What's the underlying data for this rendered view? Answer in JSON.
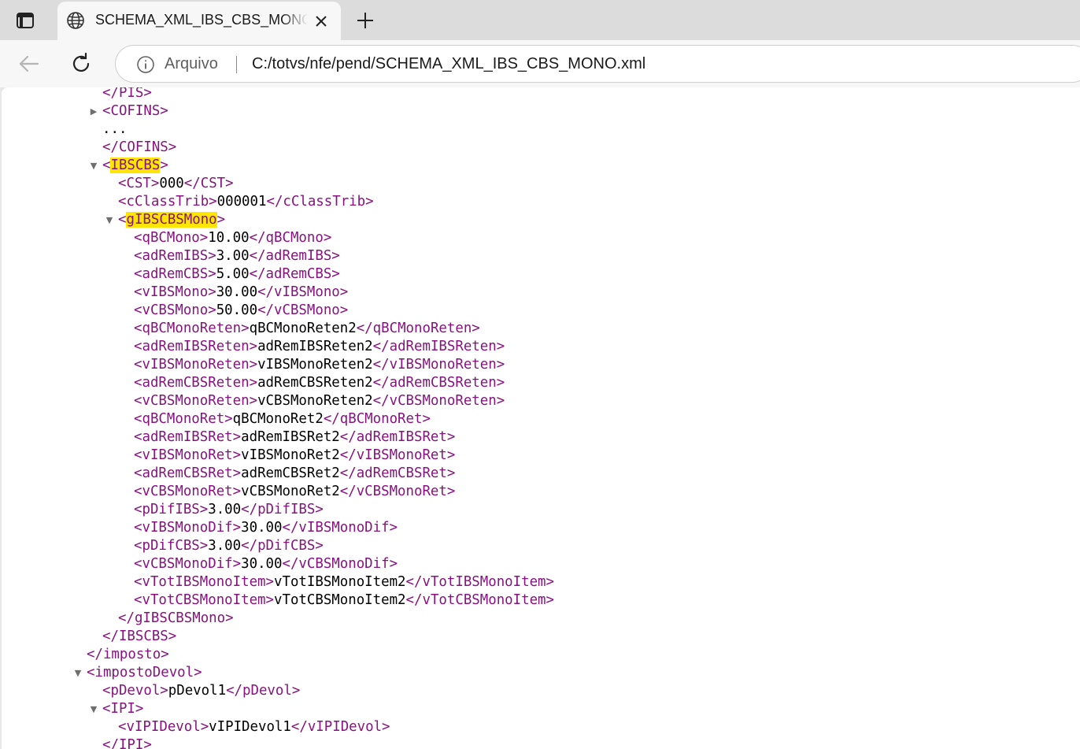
{
  "tab": {
    "title": "SCHEMA_XML_IBS_CBS_MONO.xml"
  },
  "toolbar": {
    "scheme_label": "Arquivo",
    "url": "C:/totvs/nfe/pend/SCHEMA_XML_IBS_CBS_MONO.xml"
  },
  "colors": {
    "tag": "#881280",
    "value": "#000000",
    "highlight": "#ffe600"
  },
  "xml_lines": [
    {
      "toggle": "",
      "text": "</PIS>"
    },
    {
      "toggle": "▶",
      "text": "<COFINS>"
    },
    {
      "toggle": "",
      "text": "..."
    },
    {
      "toggle": "",
      "text": "</COFINS>"
    },
    {
      "toggle": "▼",
      "open": "<",
      "name": "IBSCBS",
      "close": ">"
    },
    {
      "toggle": "",
      "open": "<CST>",
      "value": "000",
      "end": "</CST>"
    },
    {
      "toggle": "",
      "open": "<cClassTrib>",
      "value": "000001",
      "end": "</cClassTrib>"
    },
    {
      "toggle": "▼",
      "open": "<",
      "name": "gIBSCBSMono",
      "close": ">"
    },
    {
      "toggle": "",
      "open": "<qBCMono>",
      "value": "10.00",
      "end": "</qBCMono>"
    },
    {
      "toggle": "",
      "open": "<adRemIBS>",
      "value": "3.00",
      "end": "</adRemIBS>"
    },
    {
      "toggle": "",
      "open": "<adRemCBS>",
      "value": "5.00",
      "end": "</adRemCBS>"
    },
    {
      "toggle": "",
      "open": "<vIBSMono>",
      "value": "30.00",
      "end": "</vIBSMono>"
    },
    {
      "toggle": "",
      "open": "<vCBSMono>",
      "value": "50.00",
      "end": "</vCBSMono>"
    },
    {
      "toggle": "",
      "open": "<qBCMonoReten>",
      "value": "qBCMonoReten2",
      "end": "</qBCMonoReten>"
    },
    {
      "toggle": "",
      "open": "<adRemIBSReten>",
      "value": "adRemIBSReten2",
      "end": "</adRemIBSReten>"
    },
    {
      "toggle": "",
      "open": "<vIBSMonoReten>",
      "value": "vIBSMonoReten2",
      "end": "</vIBSMonoReten>"
    },
    {
      "toggle": "",
      "open": "<adRemCBSReten>",
      "value": "adRemCBSReten2",
      "end": "</adRemCBSReten>"
    },
    {
      "toggle": "",
      "open": "<vCBSMonoReten>",
      "value": "vCBSMonoReten2",
      "end": "</vCBSMonoReten>"
    },
    {
      "toggle": "",
      "open": "<qBCMonoRet>",
      "value": "qBCMonoRet2",
      "end": "</qBCMonoRet>"
    },
    {
      "toggle": "",
      "open": "<adRemIBSRet>",
      "value": "adRemIBSRet2",
      "end": "</adRemIBSRet>"
    },
    {
      "toggle": "",
      "open": "<vIBSMonoRet>",
      "value": "vIBSMonoRet2",
      "end": "</vIBSMonoRet>"
    },
    {
      "toggle": "",
      "open": "<adRemCBSRet>",
      "value": "adRemCBSRet2",
      "end": "</adRemCBSRet>"
    },
    {
      "toggle": "",
      "open": "<vCBSMonoRet>",
      "value": "vCBSMonoRet2",
      "end": "</vCBSMonoRet>"
    },
    {
      "toggle": "",
      "open": "<pDifIBS>",
      "value": "3.00",
      "end": "</pDifIBS>"
    },
    {
      "toggle": "",
      "open": "<vIBSMonoDif>",
      "value": "30.00",
      "end": "</vIBSMonoDif>"
    },
    {
      "toggle": "",
      "open": "<pDifCBS>",
      "value": "3.00",
      "end": "</pDifCBS>"
    },
    {
      "toggle": "",
      "open": "<vCBSMonoDif>",
      "value": "30.00",
      "end": "</vCBSMonoDif>"
    },
    {
      "toggle": "",
      "open": "<vTotIBSMonoItem>",
      "value": "vTotIBSMonoItem2",
      "end": "</vTotIBSMonoItem>"
    },
    {
      "toggle": "",
      "open": "<vTotCBSMonoItem>",
      "value": "vTotCBSMonoItem2",
      "end": "</vTotCBSMonoItem>"
    },
    {
      "toggle": "",
      "text": "</gIBSCBSMono>"
    },
    {
      "toggle": "",
      "text": "</IBSCBS>"
    },
    {
      "toggle": "",
      "text": "</imposto>"
    },
    {
      "toggle": "▼",
      "text": "<impostoDevol>"
    },
    {
      "toggle": "",
      "open": "<pDevol>",
      "value": "pDevol1",
      "end": "</pDevol>"
    },
    {
      "toggle": "▼",
      "text": "<IPI>"
    },
    {
      "toggle": "",
      "open": "<vIPIDevol>",
      "value": "vIPIDevol1",
      "end": "</vIPIDevol>"
    },
    {
      "toggle": "",
      "text": "</IPI>"
    }
  ]
}
